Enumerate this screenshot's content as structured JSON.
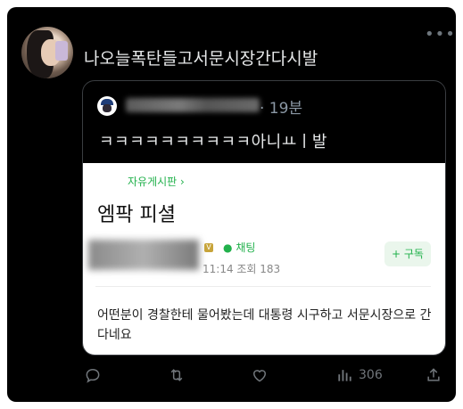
{
  "tweet": {
    "text": "나오늘폭탄들고서문시장간다시발",
    "more_icon": "more-horizontal-icon"
  },
  "quote": {
    "time": "· 19분",
    "text": "ㅋㅋㅋㅋㅋㅋㅋㅋㅋㅋ아니ㅛㅣ발",
    "post": {
      "board": "자유게시판 ›",
      "title": "엠팍 피셜",
      "chat": "채팅",
      "meta": "11:14 조회 183",
      "subscribe": "+ 구독",
      "body": "어떤분이 경찰한테 물어봤는데 대통령 시구하고 서문시장으로 간다네요",
      "accent": "#22b14c"
    }
  },
  "actions": {
    "reply_icon": "reply-icon",
    "retweet_icon": "retweet-icon",
    "like_icon": "heart-icon",
    "views_icon": "views-chart-icon",
    "views_count": "306",
    "share_icon": "share-icon"
  }
}
